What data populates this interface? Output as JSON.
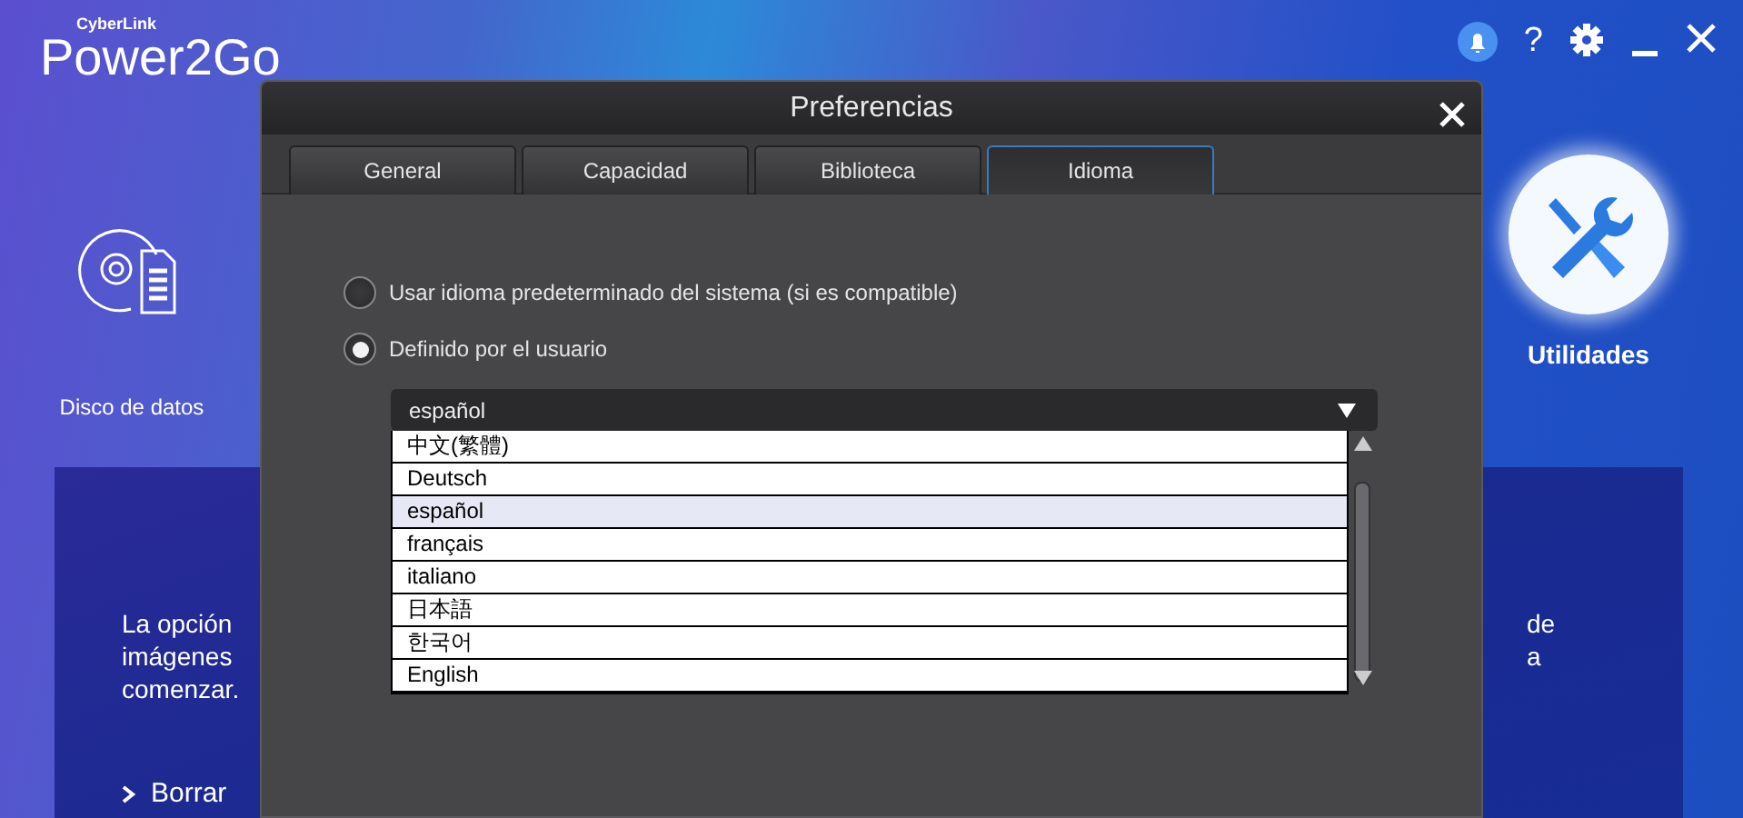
{
  "app": {
    "brand_small": "CyberLink",
    "brand": "Power2Go",
    "help": "?"
  },
  "shortcuts": [
    {
      "label": "Disco de datos",
      "kind": "disc",
      "selected": false
    },
    {
      "label": "Utilidades",
      "kind": "tools",
      "selected": true
    }
  ],
  "panel": {
    "lines_left": [
      "La opción",
      "imágenes",
      "comenzar."
    ],
    "lines_right": [
      "de",
      "a"
    ],
    "link": "Borrar"
  },
  "dialog": {
    "title": "Preferencias",
    "tabs": [
      {
        "label": "General",
        "selected": false
      },
      {
        "label": "Capacidad",
        "selected": false
      },
      {
        "label": "Biblioteca",
        "selected": false
      },
      {
        "label": "Idioma",
        "selected": true
      }
    ],
    "options": [
      {
        "label": "Usar idioma predeterminado del sistema (si es compatible)",
        "selected": false
      },
      {
        "label": "Definido por el usuario",
        "selected": true
      }
    ],
    "dropdown": {
      "value": "español",
      "expanded": true
    },
    "languages": [
      {
        "label": "中文(繁體)",
        "selected": false
      },
      {
        "label": "Deutsch",
        "selected": false
      },
      {
        "label": "español",
        "selected": true
      },
      {
        "label": "français",
        "selected": false
      },
      {
        "label": "italiano",
        "selected": false
      },
      {
        "label": "日本語",
        "selected": false
      },
      {
        "label": "한국어",
        "selected": false
      },
      {
        "label": "English",
        "selected": false
      }
    ]
  }
}
